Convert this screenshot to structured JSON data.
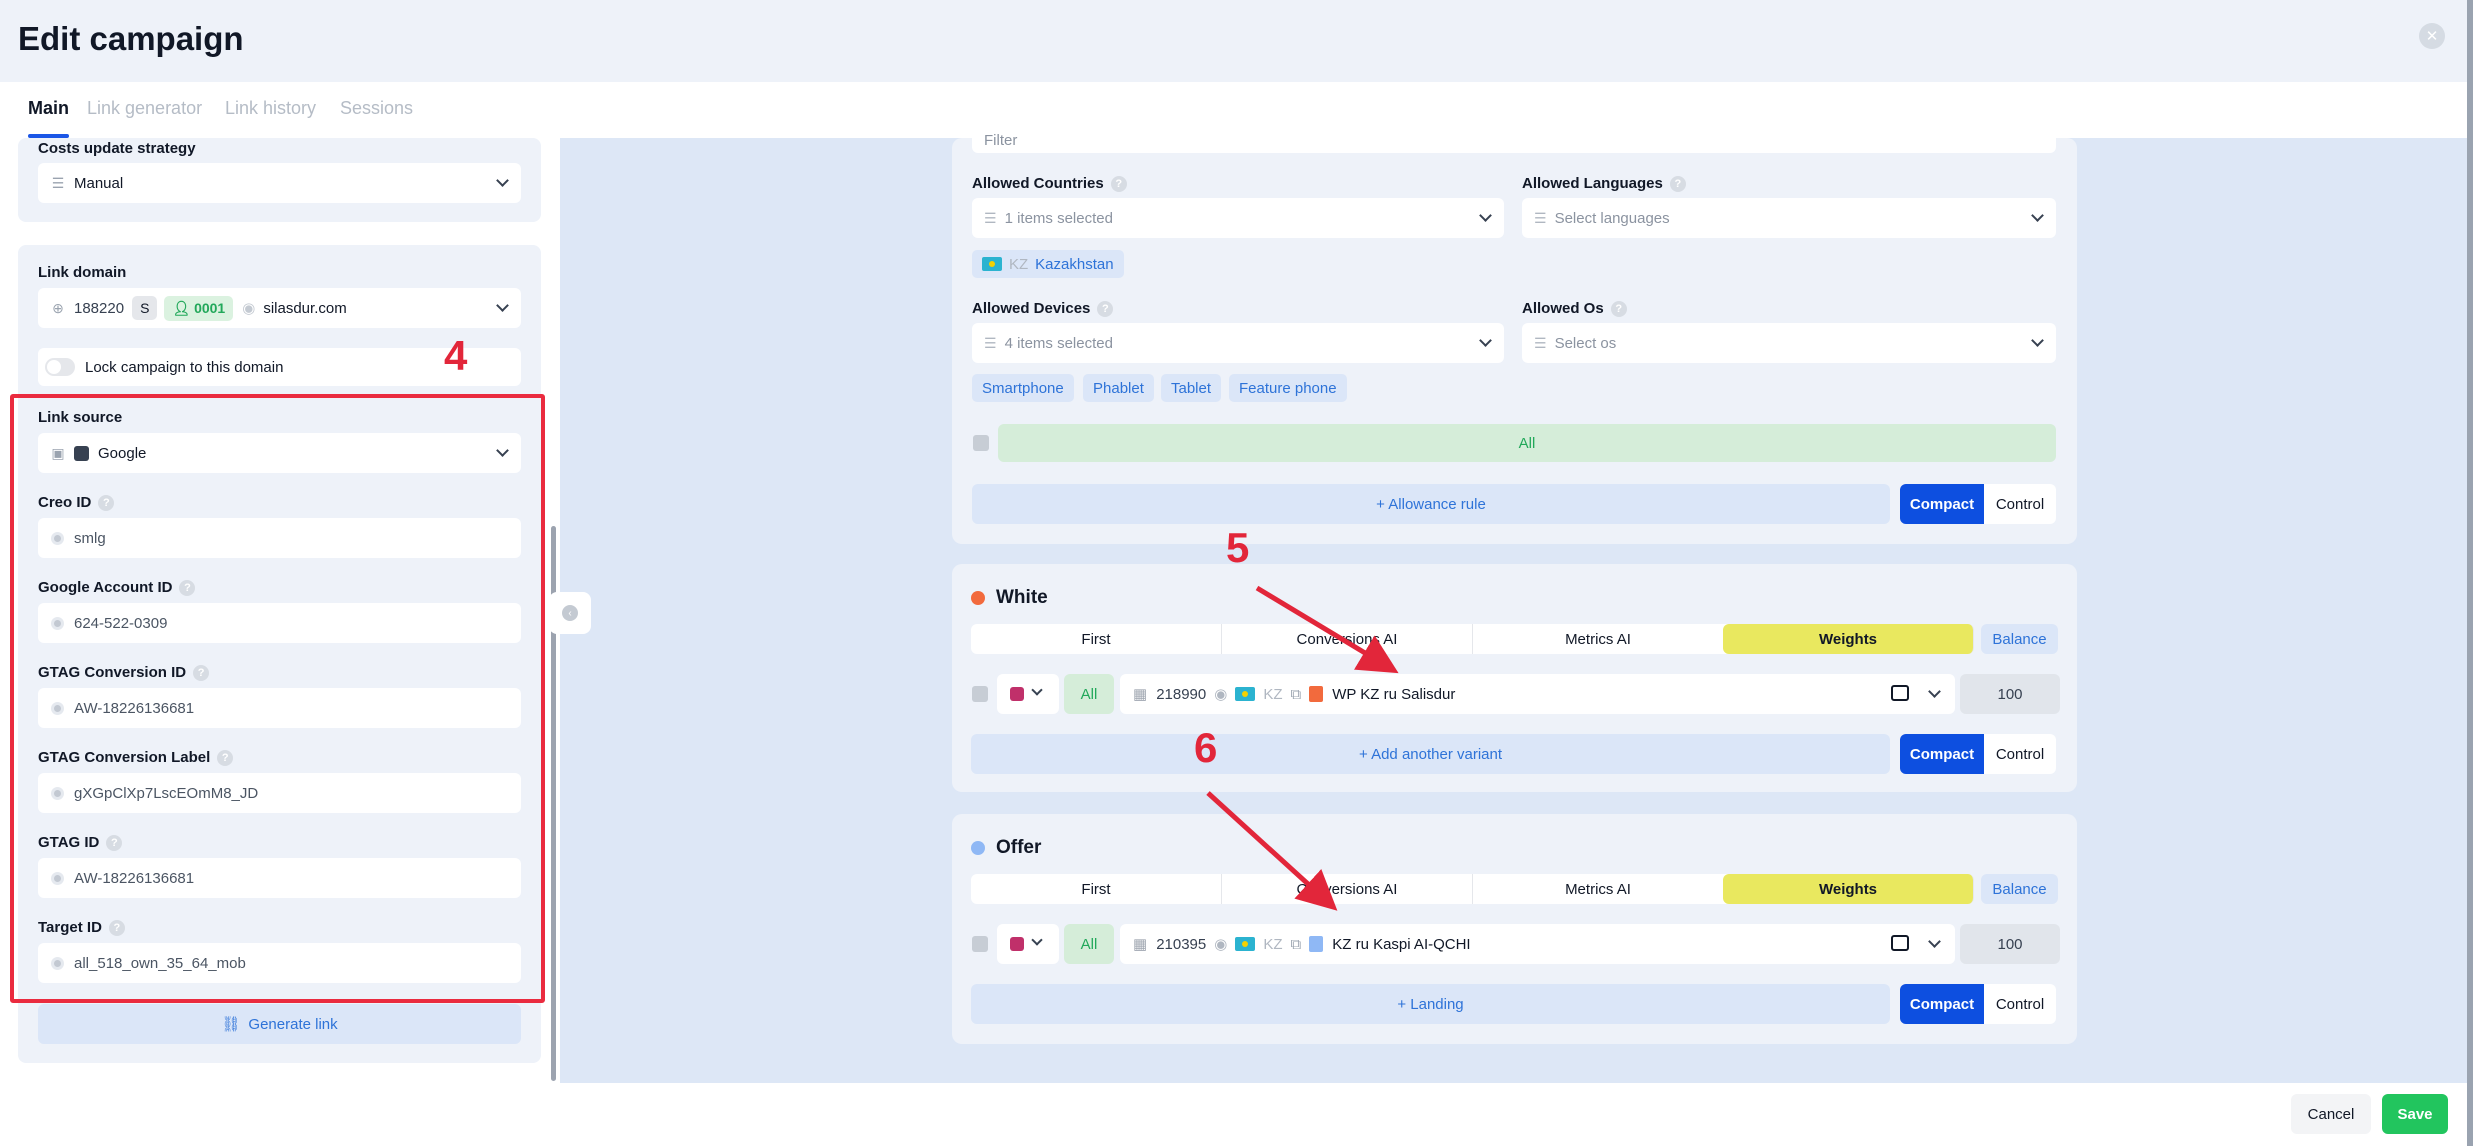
{
  "header": {
    "title": "Edit campaign"
  },
  "tabs": [
    {
      "label": "Main"
    },
    {
      "label": "Link generator"
    },
    {
      "label": "Link history"
    },
    {
      "label": "Sessions"
    }
  ],
  "left": {
    "costs_label": "Costs update strategy",
    "costs_value": "Manual",
    "link_domain_label": "Link domain",
    "domain_id": "188220",
    "domain_badge": "S",
    "domain_user": "0001",
    "domain_name": "silasdur.com",
    "lock_label": "Lock campaign to this domain",
    "link_source_label": "Link source",
    "link_source_value": "Google",
    "fields": [
      {
        "label": "Creo ID",
        "value": "smlg"
      },
      {
        "label": "Google Account ID",
        "value": "624-522-0309"
      },
      {
        "label": "GTAG Conversion ID",
        "value": "AW-18226136681"
      },
      {
        "label": "GTAG Conversion Label",
        "value": "gXGpClXp7LscEOmM8_JD"
      },
      {
        "label": "GTAG ID",
        "value": "AW-18226136681"
      },
      {
        "label": "Target ID",
        "value": "all_518_own_35_64_mob"
      }
    ],
    "generate_link": "Generate link"
  },
  "annotations": {
    "a4": "4",
    "a5": "5",
    "a6": "6",
    "color": "#e2263a"
  },
  "allowance": {
    "filter_placeholder": "Filter",
    "countries_label": "Allowed Countries",
    "countries_value": "1 items selected",
    "country_chip_code": "KZ",
    "country_chip_name": "Kazakhstan",
    "languages_label": "Allowed Languages",
    "languages_placeholder": "Select languages",
    "devices_label": "Allowed Devices",
    "devices_value": "4 items selected",
    "device_chips": [
      "Smartphone",
      "Phablet",
      "Tablet",
      "Feature phone"
    ],
    "os_label": "Allowed Os",
    "os_placeholder": "Select os",
    "all_label": "All",
    "allowance_rule": "+ Allowance rule",
    "compact": "Compact",
    "control": "Control"
  },
  "white": {
    "title": "White",
    "dot_color": "#f26a3d",
    "modes": [
      "First",
      "Conversions AI",
      "Metrics AI",
      "Weights"
    ],
    "balance": "Balance",
    "variant": {
      "all": "All",
      "id": "218990",
      "geo": "KZ",
      "name": "WP KZ ru Salisdur",
      "weight": "100"
    },
    "add": "+ Add another variant",
    "compact": "Compact",
    "control": "Control"
  },
  "offer": {
    "title": "Offer",
    "dot_color": "#8fb8f5",
    "modes": [
      "First",
      "Conversions AI",
      "Metrics AI",
      "Weights"
    ],
    "balance": "Balance",
    "variant": {
      "all": "All",
      "id": "210395",
      "geo": "KZ",
      "name": "KZ ru Kaspi AI-QCHI",
      "weight": "100"
    },
    "add": "+ Landing",
    "compact": "Compact",
    "control": "Control"
  },
  "footer": {
    "cancel": "Cancel",
    "save": "Save"
  }
}
